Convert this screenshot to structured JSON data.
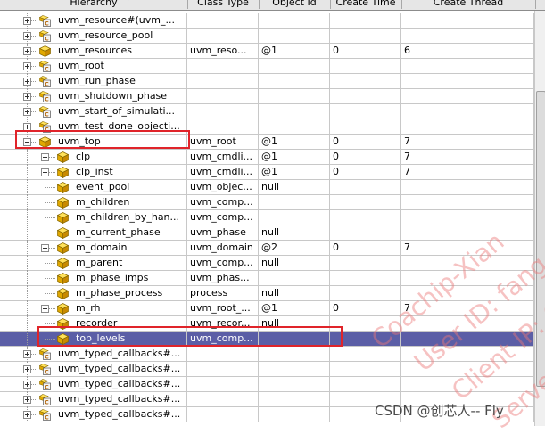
{
  "columns": {
    "hierarchy": "Hierarchy",
    "class_type": "Class Type",
    "object_id": "Object Id",
    "create_time": "Create Time",
    "create_thread": "Create Thread"
  },
  "rows": [
    {
      "name": "uvm_resource#(uvm_...",
      "class": "",
      "obj": "",
      "ctime": "",
      "cthread": "",
      "level": 0,
      "exp": "plus",
      "icon": "component-doc-icon"
    },
    {
      "name": "uvm_resource_pool",
      "class": "",
      "obj": "",
      "ctime": "",
      "cthread": "",
      "level": 0,
      "exp": "plus",
      "icon": "component-doc-icon"
    },
    {
      "name": "uvm_resources",
      "class": "uvm_reso...",
      "obj": "@1",
      "ctime": "0",
      "cthread": "6",
      "level": 0,
      "exp": "plus",
      "icon": "object-cube-icon"
    },
    {
      "name": "uvm_root",
      "class": "",
      "obj": "",
      "ctime": "",
      "cthread": "",
      "level": 0,
      "exp": "plus",
      "icon": "component-doc-icon"
    },
    {
      "name": "uvm_run_phase",
      "class": "",
      "obj": "",
      "ctime": "",
      "cthread": "",
      "level": 0,
      "exp": "plus",
      "icon": "component-doc-icon"
    },
    {
      "name": "uvm_shutdown_phase",
      "class": "",
      "obj": "",
      "ctime": "",
      "cthread": "",
      "level": 0,
      "exp": "plus",
      "icon": "component-doc-icon"
    },
    {
      "name": "uvm_start_of_simulati...",
      "class": "",
      "obj": "",
      "ctime": "",
      "cthread": "",
      "level": 0,
      "exp": "plus",
      "icon": "component-doc-icon"
    },
    {
      "name": "uvm_test_done_objecti...",
      "class": "",
      "obj": "",
      "ctime": "",
      "cthread": "",
      "level": 0,
      "exp": "plus",
      "icon": "component-doc-icon"
    },
    {
      "name": "uvm_top",
      "class": "uvm_root",
      "obj": "@1",
      "ctime": "0",
      "cthread": "7",
      "level": 0,
      "exp": "minus",
      "icon": "object-cube-icon"
    },
    {
      "name": "clp",
      "class": "uvm_cmdli...",
      "obj": "@1",
      "ctime": "0",
      "cthread": "7",
      "level": 1,
      "exp": "plus",
      "icon": "object-cube-icon"
    },
    {
      "name": "clp_inst",
      "class": "uvm_cmdli...",
      "obj": "@1",
      "ctime": "0",
      "cthread": "7",
      "level": 1,
      "exp": "plus",
      "icon": "object-cube-icon"
    },
    {
      "name": "event_pool",
      "class": "uvm_objec...",
      "obj": "null",
      "ctime": "",
      "cthread": "",
      "level": 1,
      "exp": "",
      "icon": "object-cube-icon"
    },
    {
      "name": "m_children",
      "class": "uvm_comp...",
      "obj": "",
      "ctime": "",
      "cthread": "",
      "level": 1,
      "exp": "",
      "icon": "object-cube-icon"
    },
    {
      "name": "m_children_by_han...",
      "class": "uvm_comp...",
      "obj": "",
      "ctime": "",
      "cthread": "",
      "level": 1,
      "exp": "",
      "icon": "object-cube-icon"
    },
    {
      "name": "m_current_phase",
      "class": "uvm_phase",
      "obj": "null",
      "ctime": "",
      "cthread": "",
      "level": 1,
      "exp": "",
      "icon": "object-cube-icon"
    },
    {
      "name": "m_domain",
      "class": "uvm_domain",
      "obj": "@2",
      "ctime": "0",
      "cthread": "7",
      "level": 1,
      "exp": "plus",
      "icon": "object-cube-icon"
    },
    {
      "name": "m_parent",
      "class": "uvm_comp...",
      "obj": "null",
      "ctime": "",
      "cthread": "",
      "level": 1,
      "exp": "",
      "icon": "object-cube-icon"
    },
    {
      "name": "m_phase_imps",
      "class": "uvm_phas...",
      "obj": "",
      "ctime": "",
      "cthread": "",
      "level": 1,
      "exp": "",
      "icon": "object-cube-icon"
    },
    {
      "name": "m_phase_process",
      "class": "process",
      "obj": "null",
      "ctime": "",
      "cthread": "",
      "level": 1,
      "exp": "",
      "icon": "object-cube-icon"
    },
    {
      "name": "m_rh",
      "class": "uvm_root_...",
      "obj": "@1",
      "ctime": "0",
      "cthread": "7",
      "level": 1,
      "exp": "plus",
      "icon": "object-cube-icon"
    },
    {
      "name": "recorder",
      "class": "uvm_recor...",
      "obj": "null",
      "ctime": "",
      "cthread": "",
      "level": 1,
      "exp": "",
      "icon": "object-cube-icon"
    },
    {
      "name": "top_levels",
      "class": "uvm_comp...",
      "obj": "",
      "ctime": "",
      "cthread": "",
      "level": 1,
      "exp": "",
      "icon": "object-cube-icon",
      "selected": true
    },
    {
      "name": "uvm_typed_callbacks#...",
      "class": "",
      "obj": "",
      "ctime": "",
      "cthread": "",
      "level": 0,
      "exp": "plus",
      "icon": "component-doc-icon"
    },
    {
      "name": "uvm_typed_callbacks#...",
      "class": "",
      "obj": "",
      "ctime": "",
      "cthread": "",
      "level": 0,
      "exp": "plus",
      "icon": "component-doc-icon"
    },
    {
      "name": "uvm_typed_callbacks#...",
      "class": "",
      "obj": "",
      "ctime": "",
      "cthread": "",
      "level": 0,
      "exp": "plus",
      "icon": "component-doc-icon"
    },
    {
      "name": "uvm_typed_callbacks#...",
      "class": "",
      "obj": "",
      "ctime": "",
      "cthread": "",
      "level": 0,
      "exp": "plus",
      "icon": "component-doc-icon"
    },
    {
      "name": "uvm_typed_callbacks#...",
      "class": "",
      "obj": "",
      "ctime": "",
      "cthread": "",
      "level": 0,
      "exp": "plus",
      "icon": "component-doc-icon"
    }
  ],
  "watermark": {
    "lines": [
      "Coachip-Xian",
      "User ID: fang",
      "Client IP: 6",
      "Server d"
    ],
    "footer": "CSDN @创芯人-- Fly"
  },
  "colors": {
    "selection": "#5b5ea6",
    "highlight_box": "#e0242a",
    "watermark": "#eb7878"
  }
}
